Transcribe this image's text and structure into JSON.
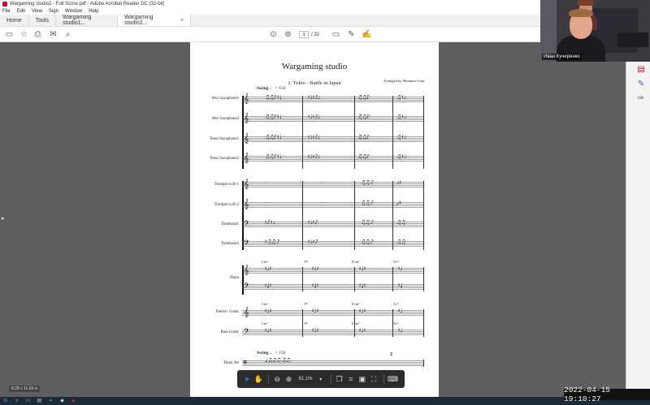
{
  "window": {
    "title": "Wargaming studio2 - Full Score.pdf - Adobe Acrobat Reader DC (32-bit)"
  },
  "menu": [
    "File",
    "Edit",
    "View",
    "Sign",
    "Window",
    "Help"
  ],
  "tabs": [
    {
      "label": "Home"
    },
    {
      "label": "Tools"
    },
    {
      "label": "Wargaming studio1..."
    },
    {
      "label": "Wargaming studio2...",
      "close": "×"
    }
  ],
  "toolbar": {
    "page_current": "1",
    "page_total": "/ 32"
  },
  "score": {
    "title": "Wargaming studio",
    "subtitle": "1. Tokio - Battle in Japan",
    "arranged": "Arranged by Shuumov Ivan",
    "tempo_label": "Swing",
    "tempo_value": "♩ = 150",
    "drum_tempo_label": "Swing",
    "drum_tempo_value": "♩ = 150",
    "instruments": [
      "Alto Saxophone1",
      "Alto Saxophone2",
      "Tenor Saxophone1",
      "Tenor Saxophone2",
      "Trumpet in B♭1",
      "Trumpet in B♭2",
      "Trombone1",
      "Trombone2",
      "Piano",
      "Electric Guitar",
      "Bass Guitar",
      "Drum Set"
    ],
    "chords": [
      "Cm⁷",
      "F⁹",
      "E♭m⁷",
      "A♭⁹"
    ],
    "drum_bar_number": "2"
  },
  "zoom": {
    "level": "81.1%"
  },
  "page_dims": "8.28 x 11.69 in",
  "overlay": {
    "datetime": "2022-04-15  19:10:27"
  },
  "webcam": {
    "name": "Иван Кучеренко"
  },
  "icons": {
    "toolbar": [
      "save-icon",
      "bookmark-icon",
      "print-icon",
      "email-icon",
      "search-icon",
      "page-up-icon",
      "page-down-icon",
      "comment-icon",
      "pen-icon",
      "sign-icon"
    ],
    "float": [
      "select-icon",
      "hand-icon",
      "zoom-out-icon",
      "zoom-in-icon",
      "copy-icon",
      "crop-icon",
      "fit-page-icon",
      "fullscreen-icon",
      "keyboard-icon"
    ]
  }
}
